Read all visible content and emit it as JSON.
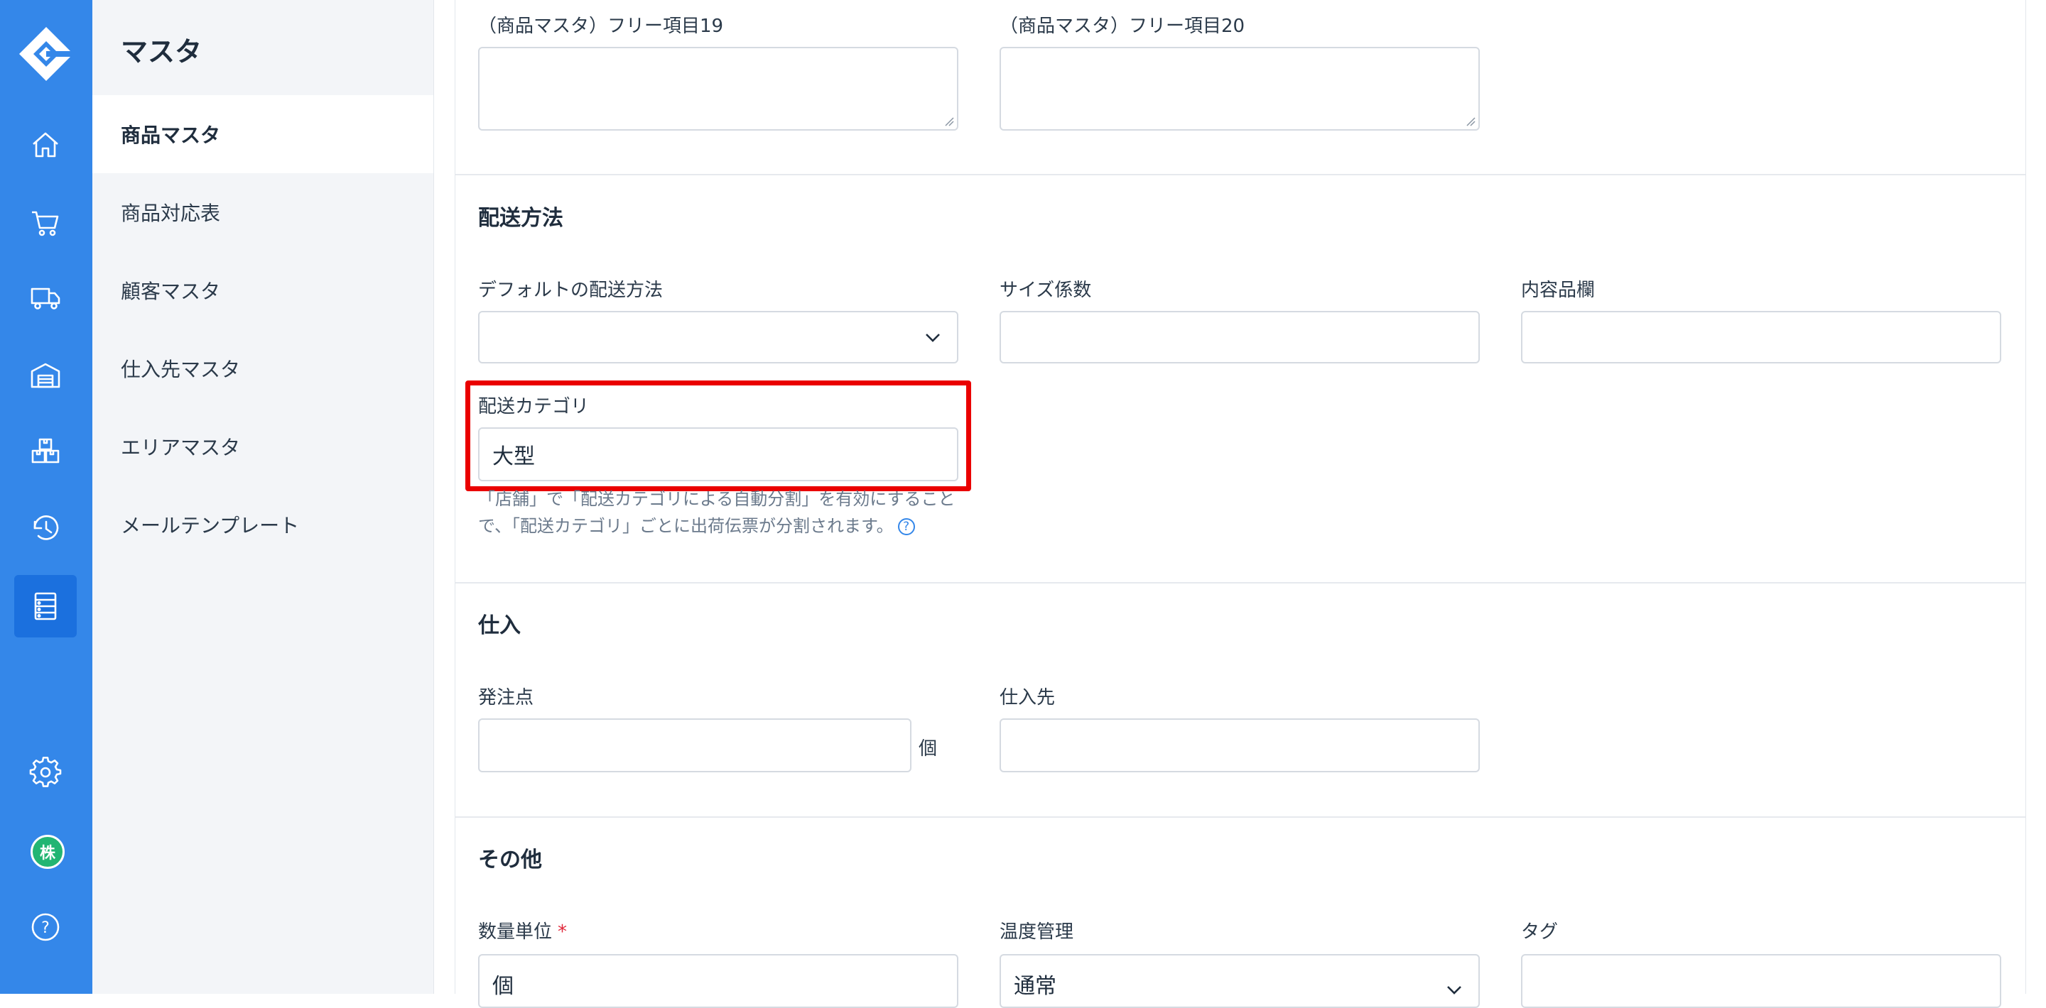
{
  "sidebar": {
    "title": "マスタ",
    "items": [
      {
        "label": "商品マスタ"
      },
      {
        "label": "商品対応表"
      },
      {
        "label": "顧客マスタ"
      },
      {
        "label": "仕入先マスタ"
      },
      {
        "label": "エリアマスタ"
      },
      {
        "label": "メールテンプレート"
      }
    ]
  },
  "rail": {
    "icons": [
      "logo-icon",
      "home-icon",
      "cart-icon",
      "truck-icon",
      "warehouse-icon",
      "boxes-icon",
      "history-icon",
      "master-icon",
      "gear-icon",
      "avatar",
      "help-icon"
    ],
    "avatar_text": "株",
    "help_text": "?"
  },
  "free_items": {
    "item19_label": "（商品マスタ）フリー項目19",
    "item20_label": "（商品マスタ）フリー項目20"
  },
  "shipping": {
    "title": "配送方法",
    "default_method_label": "デフォルトの配送方法",
    "default_method_value": "",
    "size_factor_label": "サイズ係数",
    "contents_label": "内容品欄",
    "category_label": "配送カテゴリ",
    "category_value": "大型",
    "help_text": "「店舗」で「配送カテゴリによる自動分割」を有効にすることで、「配送カテゴリ」ごとに出荷伝票が分割されます。",
    "help_icon": "?"
  },
  "purchase": {
    "title": "仕入",
    "reorder_point_label": "発注点",
    "reorder_unit": "個",
    "supplier_label": "仕入先"
  },
  "other": {
    "title": "その他",
    "quantity_unit_label": "数量単位",
    "required_mark": "*",
    "quantity_unit_value": "個",
    "temperature_label": "温度管理",
    "temperature_value": "通常",
    "tag_label": "タグ"
  },
  "colors": {
    "rail": "#3487e9",
    "rail_active": "#1b70de",
    "highlight": "#ea0000",
    "avatar": "#22b573"
  }
}
